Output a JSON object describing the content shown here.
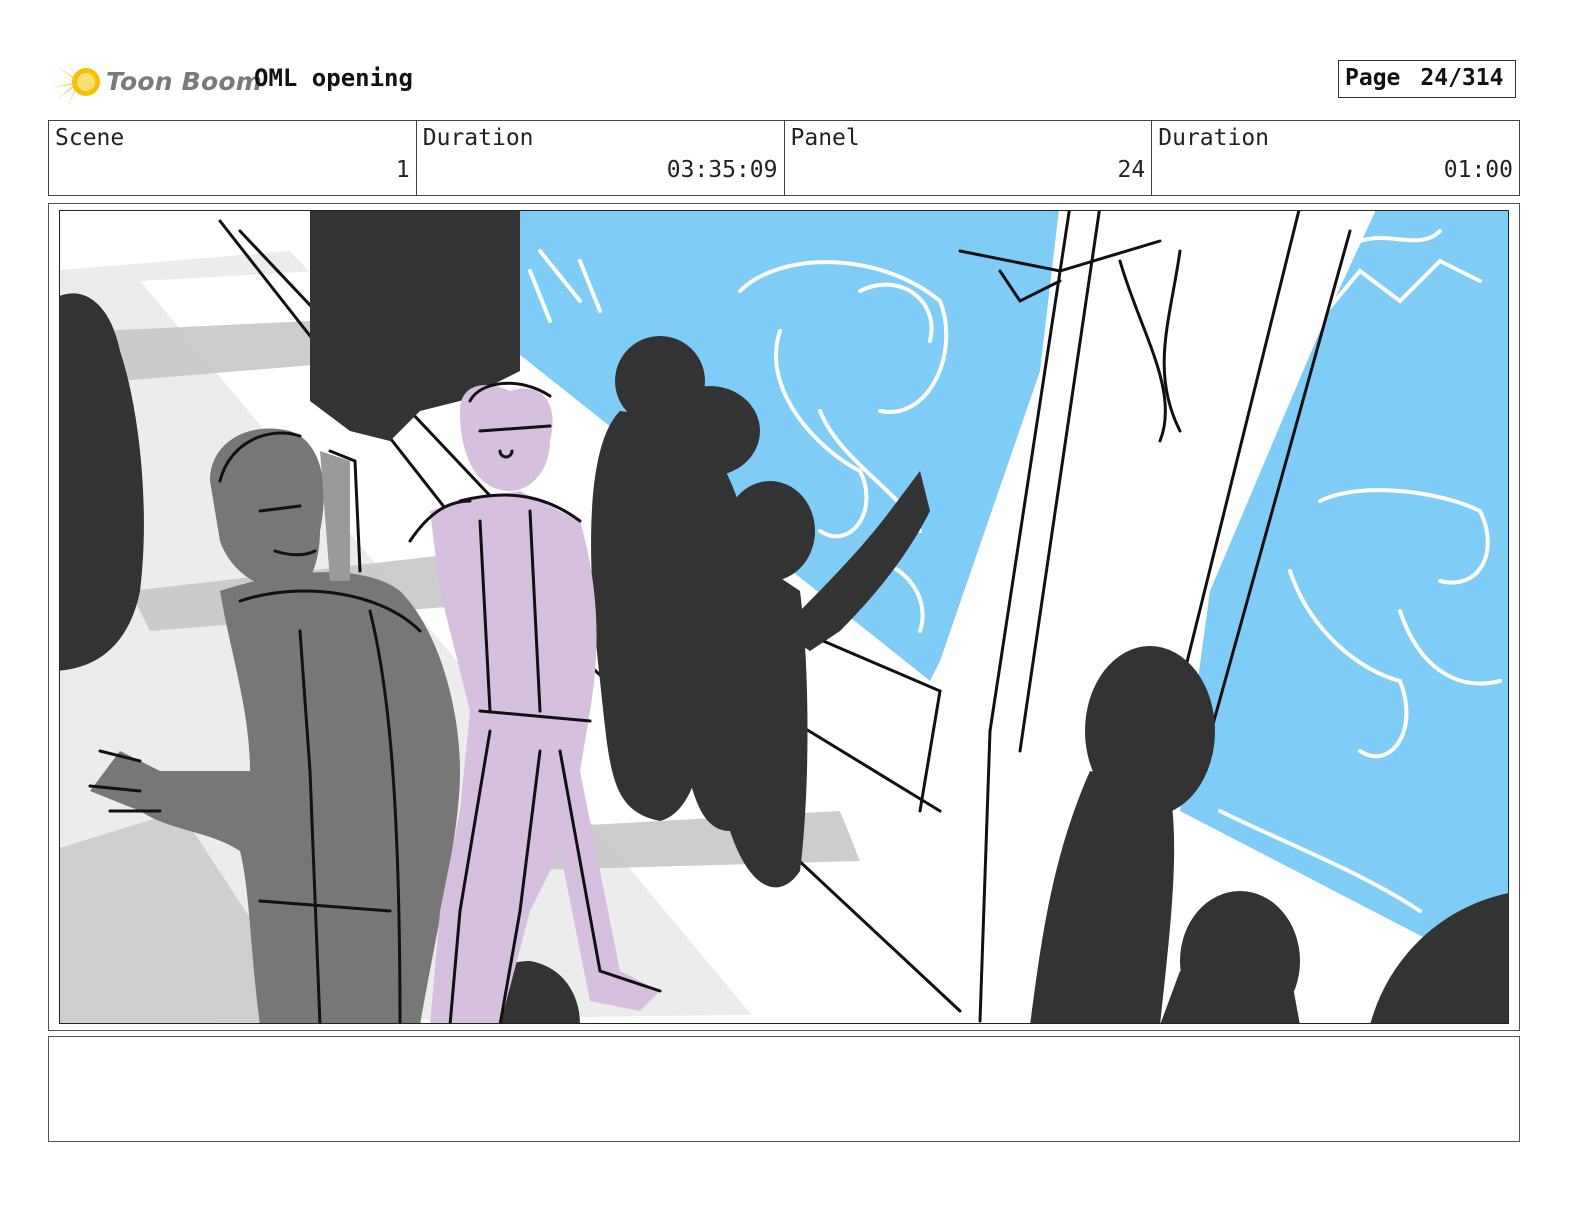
{
  "header": {
    "logo_text": "Toon Boom",
    "logo_icon": "starburst-logo-icon",
    "project_title": "OML opening",
    "page_label": "Page",
    "page_value": "24/314"
  },
  "info": {
    "scene_label": "Scene",
    "scene_value": "1",
    "scene_duration_label": "Duration",
    "scene_duration_value": "03:35:09",
    "panel_label": "Panel",
    "panel_value": "24",
    "panel_duration_label": "Duration",
    "panel_duration_value": "01:00"
  },
  "colors": {
    "sky_blue": "#7fcdf7",
    "lilac": "#d7bfe0",
    "dark_silhouette": "#333333",
    "grey_figure": "#777777",
    "light_grey": "#c8c8c8",
    "logo_yellow": "#f6c100"
  }
}
